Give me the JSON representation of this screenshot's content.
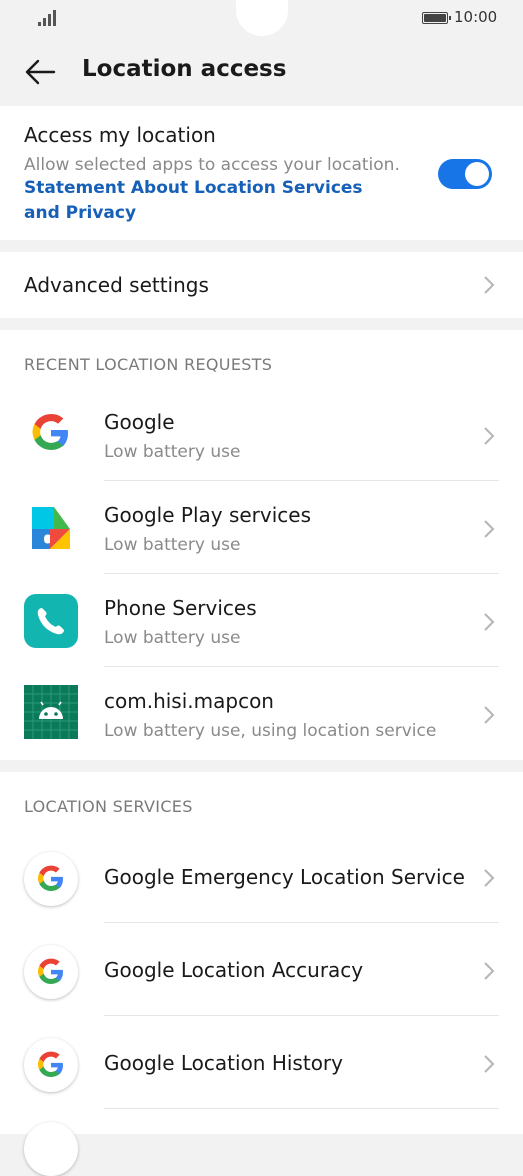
{
  "status_bar": {
    "time": "10:00"
  },
  "header": {
    "title": "Location access"
  },
  "access": {
    "title": "Access my location",
    "description": "Allow selected apps to access your location.",
    "link": "Statement About Location Services and Privacy",
    "toggle_on": true
  },
  "advanced": {
    "label": "Advanced settings"
  },
  "recent": {
    "header": "RECENT LOCATION REQUESTS",
    "items": [
      {
        "name": "Google",
        "detail": "Low battery use",
        "icon": "google-g-icon"
      },
      {
        "name": "Google Play services",
        "detail": "Low battery use",
        "icon": "google-play-services-icon"
      },
      {
        "name": "Phone Services",
        "detail": "Low battery use",
        "icon": "phone-services-icon"
      },
      {
        "name": "com.hisi.mapcon",
        "detail": "Low battery use, using location service",
        "icon": "android-icon"
      }
    ]
  },
  "services": {
    "header": "LOCATION SERVICES",
    "items": [
      {
        "name": "Google Emergency Location Service",
        "icon": "google-g-icon"
      },
      {
        "name": "Google Location Accuracy",
        "icon": "google-g-icon"
      },
      {
        "name": "Google Location History",
        "icon": "google-g-icon"
      }
    ]
  },
  "colors": {
    "accent": "#1875e8",
    "link": "#1760b8",
    "background": "#f2f2f2"
  }
}
